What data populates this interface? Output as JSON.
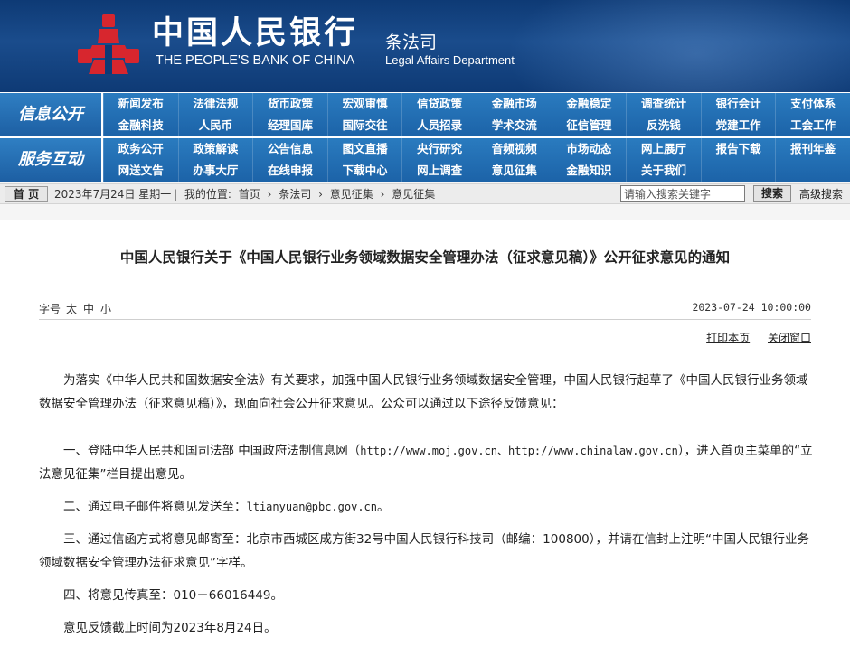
{
  "header": {
    "bank_name_cn": "中国人民银行",
    "bank_name_en": "THE PEOPLE'S BANK OF CHINA",
    "dept_cn": "条法司",
    "dept_en": "Legal Affairs Department",
    "logo_color": "#d7262e"
  },
  "nav": {
    "rows": [
      {
        "label": "信息公开",
        "items": [
          "新闻发布",
          "法律法规",
          "货币政策",
          "宏观审慎",
          "信贷政策",
          "金融市场",
          "金融稳定",
          "调查统计",
          "银行会计",
          "支付体系",
          "金融科技",
          "人民币",
          "经理国库",
          "国际交往",
          "人员招录",
          "学术交流",
          "征信管理",
          "反洗钱",
          "党建工作",
          "工会工作"
        ]
      },
      {
        "label": "服务互动",
        "items": [
          "政务公开",
          "政策解读",
          "公告信息",
          "图文直播",
          "央行研究",
          "音频视频",
          "市场动态",
          "网上展厅",
          "报告下载",
          "报刊年鉴",
          "网送文告",
          "办事大厅",
          "在线申报",
          "下载中心",
          "网上调查",
          "意见征集",
          "金融知识",
          "关于我们",
          "",
          ""
        ]
      }
    ]
  },
  "crumb": {
    "home": "首 页",
    "date": "2023年7月24日  星期一",
    "location_label": "我的位置:",
    "path": [
      "首页",
      "条法司",
      "意见征集",
      "意见征集"
    ],
    "separator": "›",
    "search_placeholder": "请输入搜索关键字",
    "search_button": "搜索",
    "advanced": "高级搜索"
  },
  "article": {
    "title": "中国人民银行关于《中国人民银行业务领域数据安全管理办法（征求意见稿）》公开征求意见的通知",
    "font_size_label": "字号",
    "size_large": "太",
    "size_medium": "中",
    "size_small": "小",
    "pubdate": "2023-07-24 10:00:00",
    "print": "打印本页",
    "close": "关闭窗口",
    "para1": "为落实《中华人民共和国数据安全法》有关要求，加强中国人民银行业务领域数据安全管理，中国人民银行起草了《中国人民银行业务领域数据安全管理办法（征求意见稿）》，现面向社会公开征求意见。公众可以通过以下途径反馈意见：",
    "item1_a": "一、登陆中华人民共和国司法部 中国政府法制信息网（",
    "item1_urls": "http://www.moj.gov.cn、http://www.chinalaw.gov.cn",
    "item1_b": "），进入首页主菜单的“立法意见征集”栏目提出意见。",
    "item2_a": "二、通过电子邮件将意见发送至：",
    "item2_email": "ltianyuan@pbc.gov.cn",
    "item2_b": "。",
    "item3": "三、通过信函方式将意见邮寄至：北京市西城区成方街32号中国人民银行科技司（邮编：100800），并请在信封上注明“中国人民银行业务领域数据安全管理办法征求意见”字样。",
    "item4": "四、将意见传真至：010－66016449。",
    "deadline": "意见反馈截止时间为2023年8月24日。"
  }
}
